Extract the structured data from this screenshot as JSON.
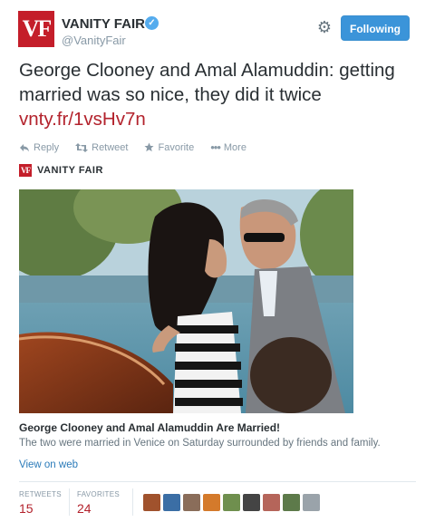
{
  "author": {
    "logo_text": "VF",
    "name": "VANITY FAIR",
    "handle": "@VanityFair",
    "verified_icon": "verified-badge-icon"
  },
  "header": {
    "follow_label": "Following",
    "settings_icon": "gear-icon"
  },
  "tweet": {
    "text": "George Clooney and Amal Alamuddin: getting married was so nice, they did it twice ",
    "link": "vnty.fr/1vsHv7n"
  },
  "actions": [
    {
      "label": "Reply",
      "icon": "reply-icon"
    },
    {
      "label": "Retweet",
      "icon": "retweet-icon"
    },
    {
      "label": "Favorite",
      "icon": "star-icon"
    },
    {
      "label": "More",
      "icon": "ellipsis-icon"
    }
  ],
  "card": {
    "brand_logo": "VF",
    "brand_name": "VANITY FAIR",
    "title": "George Clooney and Amal Alamuddin Are Married!",
    "description": "The two were married in Venice on Saturday surrounded by friends and family.",
    "view_on_web": "View on web"
  },
  "stats": {
    "retweets_label": "RETWEETS",
    "retweets_value": "15",
    "favorites_label": "FAVORITES",
    "favorites_value": "24"
  },
  "favoriters": [
    "#a0522d",
    "#3b6ea5",
    "#8a6d5a",
    "#d47a2b",
    "#6f8f4e",
    "#444444",
    "#b5655a",
    "#5d7a4a",
    "#9aa3aa"
  ],
  "colors": {
    "brand_red": "#c41e2a",
    "link_red": "#b3222c",
    "follow_blue": "#3b94d9",
    "muted_gray": "#8899a6"
  }
}
